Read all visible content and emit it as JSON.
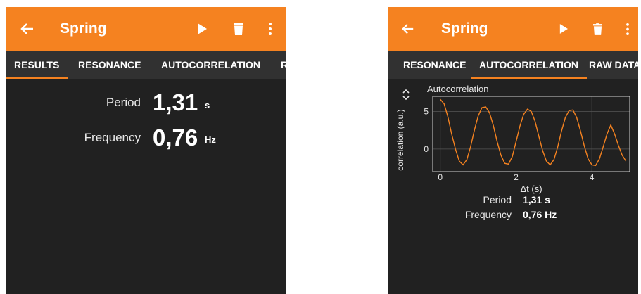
{
  "left": {
    "app_title": "Spring",
    "tabs": [
      "RESULTS",
      "RESONANCE",
      "AUTOCORRELATION",
      "R"
    ],
    "active_tab": "RESULTS",
    "results": {
      "period_label": "Period",
      "period_value": "1,31",
      "period_unit": "s",
      "frequency_label": "Frequency",
      "frequency_value": "0,76",
      "frequency_unit": "Hz"
    }
  },
  "right": {
    "app_title": "Spring",
    "tabs": [
      "RESONANCE",
      "AUTOCORRELATION",
      "RAW DATA"
    ],
    "active_tab": "AUTOCORRELATION",
    "summary": {
      "period_label": "Period",
      "period_value": "1,31 s",
      "frequency_label": "Frequency",
      "frequency_value": "0,76 Hz"
    }
  },
  "icons": [
    "back-arrow-icon",
    "play-icon",
    "delete-icon",
    "more-vert-icon",
    "expand-icon"
  ],
  "colors": {
    "accent": "#f58220",
    "background": "#212121",
    "tab_bar": "#313131",
    "line": "#f58220"
  },
  "chart_data": {
    "type": "line",
    "title": "Autocorrelation",
    "xlabel": "Δt (s)",
    "ylabel": "correlation (a.u.)",
    "xlim": [
      -0.2,
      5.0
    ],
    "ylim": [
      -3,
      7
    ],
    "xticks": [
      0,
      2,
      4
    ],
    "yticks": [
      0,
      5
    ],
    "grid": true,
    "series": [
      {
        "x": [
          0.0,
          0.1,
          0.2,
          0.3,
          0.4,
          0.5,
          0.6,
          0.7,
          0.8,
          0.9,
          1.0,
          1.1,
          1.2,
          1.3,
          1.4,
          1.5,
          1.6,
          1.7,
          1.8,
          1.9,
          2.0,
          2.1,
          2.2,
          2.3,
          2.4,
          2.5,
          2.6,
          2.7,
          2.8,
          2.9,
          3.0,
          3.1,
          3.2,
          3.3,
          3.4,
          3.5,
          3.6,
          3.7,
          3.8,
          3.9,
          4.0,
          4.1,
          4.2,
          4.3,
          4.4,
          4.5,
          4.6,
          4.7,
          4.8,
          4.9
        ],
        "y": [
          6.6,
          6.0,
          4.3,
          2.0,
          0.0,
          -1.6,
          -2.1,
          -1.4,
          0.3,
          2.5,
          4.4,
          5.5,
          5.6,
          4.8,
          3.1,
          1.0,
          -0.8,
          -1.9,
          -2.0,
          -1.0,
          1.0,
          3.0,
          4.6,
          5.3,
          5.0,
          3.7,
          1.7,
          -0.2,
          -1.6,
          -2.1,
          -1.4,
          0.3,
          2.4,
          4.2,
          5.1,
          5.2,
          4.2,
          2.4,
          0.4,
          -1.3,
          -2.1,
          -2.2,
          -1.3,
          0.3,
          2.0,
          3.2,
          2.0,
          0.5,
          -0.8,
          -1.6
        ]
      }
    ]
  }
}
